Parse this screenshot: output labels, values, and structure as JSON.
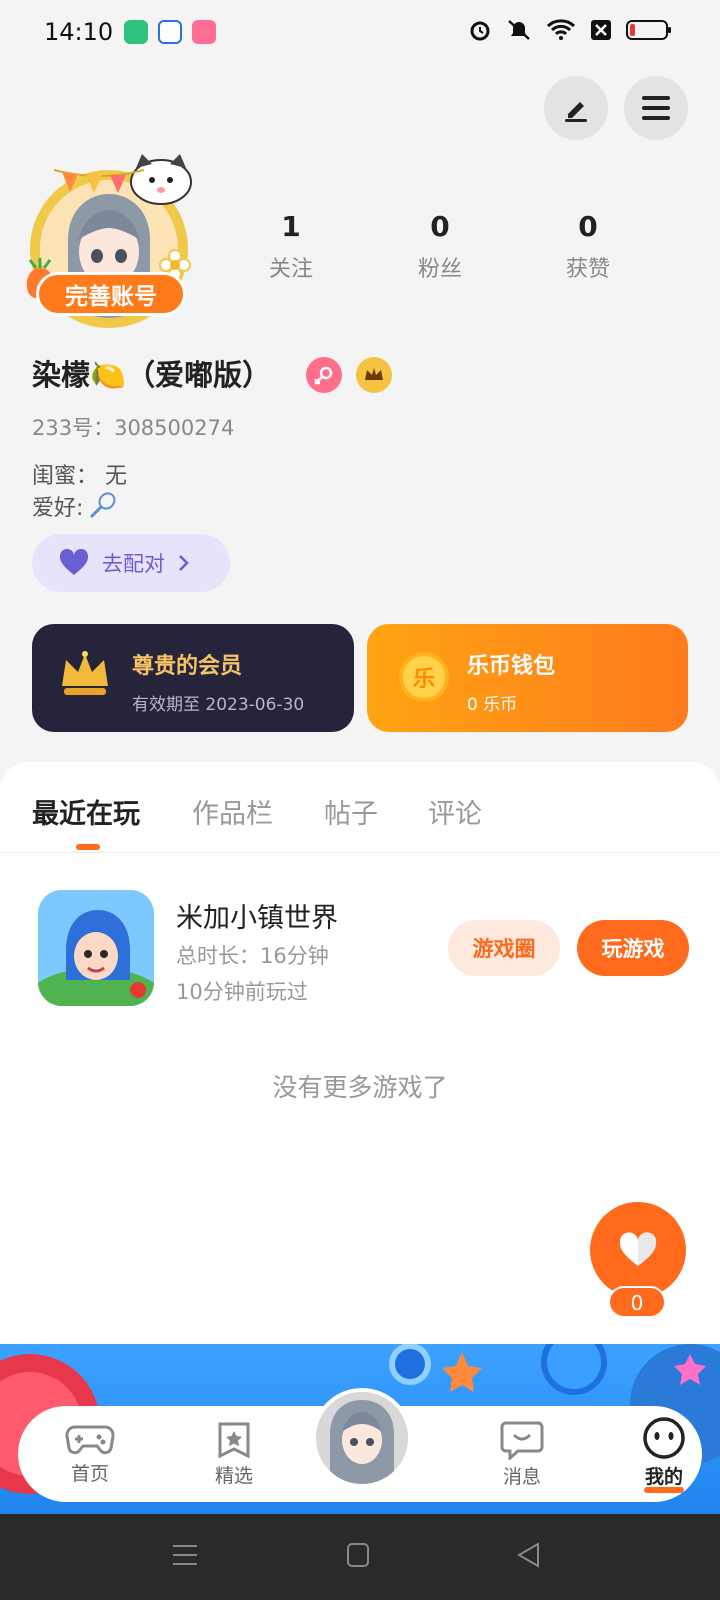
{
  "status_bar": {
    "time": "14:10"
  },
  "profile": {
    "complete_account_label": "完善账号",
    "nickname": "染檬🍋（爱嘟版）",
    "id_text": "233号：308500274",
    "bff_text": "闺蜜： 无",
    "hobby_label": "爱好:",
    "match_label": "去配对"
  },
  "stats": [
    {
      "value": "1",
      "label": "关注"
    },
    {
      "value": "0",
      "label": "粉丝"
    },
    {
      "value": "0",
      "label": "获赞"
    }
  ],
  "vip_card": {
    "title": "尊贵的会员",
    "subtitle": "有效期至 2023-06-30"
  },
  "wallet_card": {
    "title": "乐币钱包",
    "subtitle": "0 乐币",
    "coin_glyph": "乐"
  },
  "tabs": [
    {
      "label": "最近在玩",
      "active": true
    },
    {
      "label": "作品栏",
      "active": false
    },
    {
      "label": "帖子",
      "active": false
    },
    {
      "label": "评论",
      "active": false
    }
  ],
  "game": {
    "name": "米加小镇世界",
    "duration": "总时长：16分钟",
    "last_played": "10分钟前玩过",
    "circle_button": "游戏圈",
    "play_button": "玩游戏"
  },
  "no_more_text": "没有更多游戏了",
  "like_count": "0",
  "bottom_nav": [
    {
      "label": "首页",
      "icon": "gamepad-icon"
    },
    {
      "label": "精选",
      "icon": "star-bookmark-icon"
    },
    {
      "label": "消息",
      "icon": "message-icon"
    },
    {
      "label": "我的",
      "icon": "smile-face-icon",
      "active": true
    }
  ],
  "colors": {
    "accent": "#ff6a1c",
    "vip_bg": "#25243a",
    "match_bg": "#e7e3fb"
  }
}
